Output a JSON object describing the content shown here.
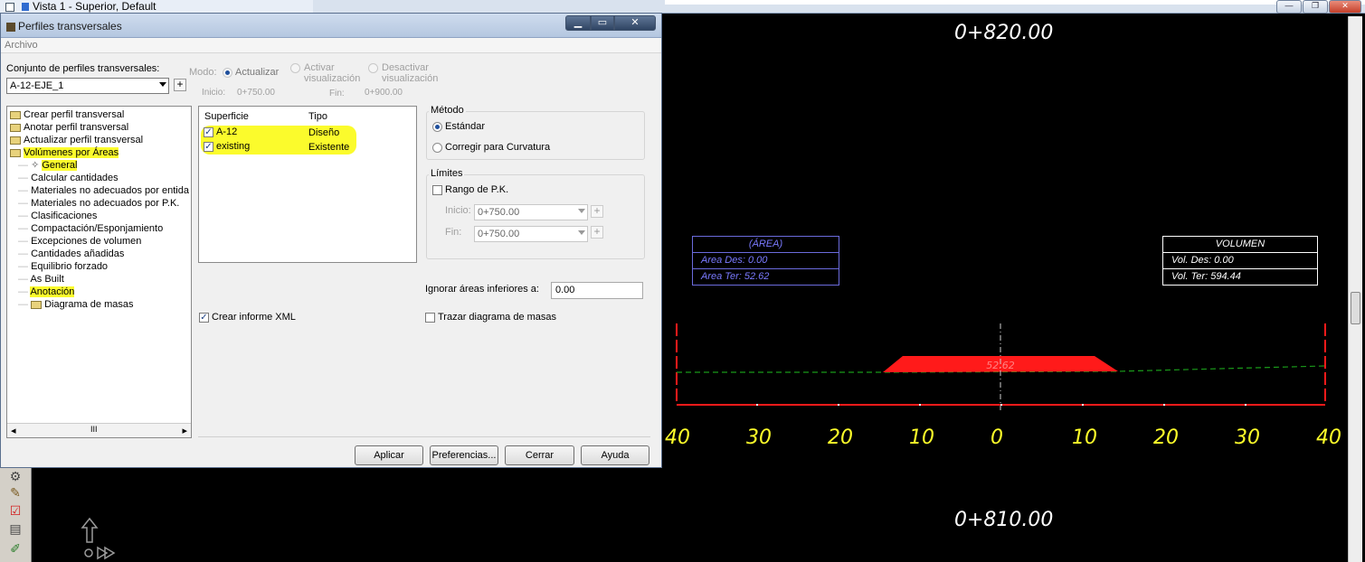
{
  "cad": {
    "window_title": "Vista 1 - Superior, Default",
    "top_station": "0+820.00",
    "bottom_station": "0+810.00",
    "axis_labels": [
      "40",
      "30",
      "20",
      "10",
      "0",
      "10",
      "20",
      "30",
      "40"
    ],
    "fill_area_label": "52.62",
    "area_box": {
      "header": "(ÁREA)",
      "des": "Area Des:  0.00",
      "ter": "Area Ter:  52.62"
    },
    "volume_box": {
      "header": "VOLUMEN",
      "des": "Vol. Des:  0.00",
      "ter": "Vol. Ter:  594.44"
    },
    "colors": {
      "background": "#000000",
      "axis_labels": "#ffff2a",
      "section_fill": "#ff1a1a",
      "ground_line": "#1a9a1a",
      "area_box": "#7a7aff"
    }
  },
  "dialog": {
    "title": "Perfiles transversales",
    "menu": "Archivo",
    "set_label": "Conjunto de perfiles transversales:",
    "set_value": "A-12-EJE_1",
    "mode_label": "Modo:",
    "mode_options": {
      "actualizar": "Actualizar",
      "activar_l1": "Activar",
      "activar_l2": "visualización",
      "desactivar_l1": "Desactivar",
      "desactivar_l2": "visualización"
    },
    "inicio_label": "Inicio:",
    "inicio_value": "0+750.00",
    "fin_label": "Fin:",
    "fin_value": "0+900.00",
    "tree": {
      "items": [
        {
          "label": "Crear perfil transversal",
          "level": 0,
          "folder": true
        },
        {
          "label": "Anotar perfil transversal",
          "level": 0,
          "folder": true
        },
        {
          "label": "Actualizar perfil transversal",
          "level": 0,
          "folder": true
        },
        {
          "label": "Volúmenes por Áreas",
          "level": 0,
          "folder": true,
          "highlight": true,
          "open": true
        },
        {
          "label": "General",
          "level": 1,
          "highlight": true,
          "selected": true
        },
        {
          "label": "Calcular cantidades",
          "level": 1
        },
        {
          "label": "Materiales no adecuados por entida",
          "level": 1
        },
        {
          "label": "Materiales no adecuados por P.K.",
          "level": 1
        },
        {
          "label": "Clasificaciones",
          "level": 1
        },
        {
          "label": "Compactación/Esponjamiento",
          "level": 1
        },
        {
          "label": "Excepciones de volumen",
          "level": 1
        },
        {
          "label": "Cantidades añadidas",
          "level": 1
        },
        {
          "label": "Equilibrio forzado",
          "level": 1
        },
        {
          "label": "As Built",
          "level": 1
        },
        {
          "label": "Anotación",
          "level": 1,
          "highlight": true
        },
        {
          "label": "Diagrama de masas",
          "level": 1,
          "folder": true
        }
      ],
      "hscroll_thumb": "III"
    },
    "surfaces": {
      "col_superficie": "Superficie",
      "col_tipo": "Tipo",
      "rows": [
        {
          "name": "A-12",
          "type": "Diseño",
          "checked": true
        },
        {
          "name": "existing",
          "type": "Existente",
          "checked": true
        }
      ]
    },
    "metodo": {
      "title": "Método",
      "estandar": "Estándar",
      "corregir": "Corregir para Curvatura"
    },
    "limites": {
      "title": "Límites",
      "rango": "Rango de P.K.",
      "inicio_label": "Inicio:",
      "inicio_value": "0+750.00",
      "fin_label": "Fin:",
      "fin_value": "0+750.00"
    },
    "ignorar_label": "Ignorar áreas inferiores a:",
    "ignorar_value": "0.00",
    "crear_xml": "Crear informe XML",
    "trazar": "Trazar diagrama de masas",
    "buttons": {
      "aplicar": "Aplicar",
      "preferencias": "Preferencias...",
      "cerrar": "Cerrar",
      "ayuda": "Ayuda"
    }
  }
}
